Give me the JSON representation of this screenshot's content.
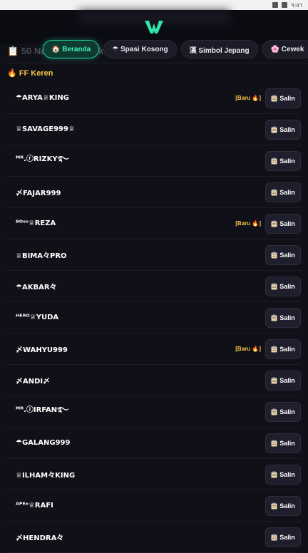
{
  "statusbar": {
    "time": "٩:٥٦"
  },
  "header": {
    "bg_title": "📋 50 Nama Simp Pakai"
  },
  "tabs": [
    {
      "label": "🏠 Beranda",
      "active": true
    },
    {
      "label": "☂ Spasi Kosong",
      "active": false
    },
    {
      "label": "漢 Simbol Jepang",
      "active": false
    },
    {
      "label": "🌸 Cewek",
      "active": false
    }
  ],
  "section": {
    "title": "🔥 FF Keren"
  },
  "copy_label": "Salin",
  "names": [
    {
      "name": "☂ARYA♕KING",
      "badge": "[Baru 🔥]"
    },
    {
      "name": "♕SAVAGE999♕",
      "badge": ""
    },
    {
      "name": "ᴹᴿ.ⓡRIZKY࿐",
      "badge": ""
    },
    {
      "name": "〆FAJAR999",
      "badge": ""
    },
    {
      "name": "ᴮᴼˢˢ♕REZA",
      "badge": "[Baru 🔥]"
    },
    {
      "name": "♕BIMA々PRO",
      "badge": ""
    },
    {
      "name": "☂AKBAR々",
      "badge": ""
    },
    {
      "name": "ᴴᴱᴿᴼ♕YUDA",
      "badge": ""
    },
    {
      "name": "〆WAHYU999",
      "badge": "[Baru 🔥]"
    },
    {
      "name": "〆ANDI〆",
      "badge": ""
    },
    {
      "name": "ᴹᴿ.ⓘIRFAN࿐",
      "badge": ""
    },
    {
      "name": "☂GALANG999",
      "badge": ""
    },
    {
      "name": "♕ILHAM々KING",
      "badge": ""
    },
    {
      "name": "ᴬᴾᴱˣ♕RAFI",
      "badge": ""
    },
    {
      "name": "〆HENDRA々",
      "badge": ""
    }
  ]
}
